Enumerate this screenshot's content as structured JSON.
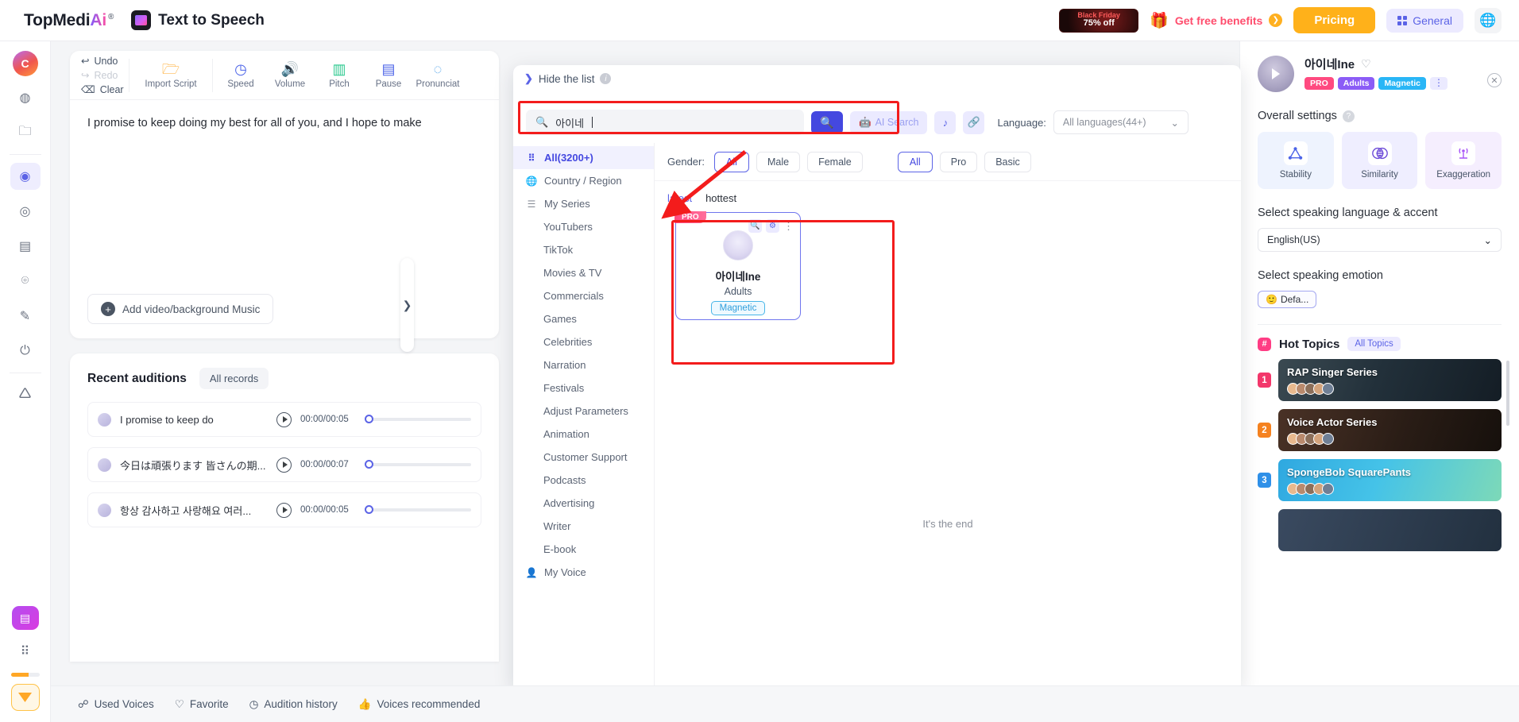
{
  "header": {
    "brand_main": "TopMedi",
    "brand_ai": "Ai",
    "brand_reg": "®",
    "app_title": "Text to Speech",
    "blackfriday_line1": "Black Friday",
    "blackfriday_line2": "75% off",
    "free_benefits": "Get free benefits",
    "pricing": "Pricing",
    "general": "General"
  },
  "rail": {
    "avatar_letter": "C"
  },
  "editor": {
    "undo": "Undo",
    "redo": "Redo",
    "clear": "Clear",
    "import_script": "Import Script",
    "tools": [
      {
        "label": "Speed"
      },
      {
        "label": "Volume"
      },
      {
        "label": "Pitch"
      },
      {
        "label": "Pause"
      },
      {
        "label": "Pronunciat"
      }
    ],
    "text": "I promise to keep doing my best for all of you, and I hope to make",
    "add_music": "Add video/background Music"
  },
  "recent": {
    "title": "Recent auditions",
    "all_records": "All records",
    "rows": [
      {
        "name": "I promise to keep do",
        "time": "00:00/00:05"
      },
      {
        "name": "今日は頑張ります 皆さんの期...",
        "time": "00:00/00:07"
      },
      {
        "name": "항상 감사하고 사랑해요 여러...",
        "time": "00:00/00:05"
      }
    ]
  },
  "bottombar": {
    "items": [
      {
        "label": "Used Voices",
        "icon": "used-voices-icon"
      },
      {
        "label": "Favorite",
        "icon": "heart-icon"
      },
      {
        "label": "Audition history",
        "icon": "clock-icon"
      },
      {
        "label": "Voices recommended",
        "icon": "thumbs-up-icon"
      }
    ]
  },
  "modal": {
    "hide_list": "Hide the list",
    "search_value": "아이네",
    "ai_search": "AI Search",
    "language_label": "Language:",
    "language_value": "All languages(44+)",
    "categories": [
      {
        "label": "All(3200+)",
        "icon": "grid-icon",
        "active": true,
        "sub": false
      },
      {
        "label": "Country / Region",
        "icon": "globe-icon",
        "active": false,
        "sub": false
      },
      {
        "label": "My Series",
        "icon": "layers-icon",
        "active": false,
        "sub": false
      },
      {
        "label": "YouTubers",
        "icon": "",
        "active": false,
        "sub": true
      },
      {
        "label": "TikTok",
        "icon": "",
        "active": false,
        "sub": true
      },
      {
        "label": "Movies & TV",
        "icon": "",
        "active": false,
        "sub": true
      },
      {
        "label": "Commercials",
        "icon": "",
        "active": false,
        "sub": true
      },
      {
        "label": "Games",
        "icon": "",
        "active": false,
        "sub": true
      },
      {
        "label": "Celebrities",
        "icon": "",
        "active": false,
        "sub": true
      },
      {
        "label": "Narration",
        "icon": "",
        "active": false,
        "sub": true
      },
      {
        "label": "Festivals",
        "icon": "",
        "active": false,
        "sub": true
      },
      {
        "label": "Adjust Parameters",
        "icon": "",
        "active": false,
        "sub": true
      },
      {
        "label": "Animation",
        "icon": "",
        "active": false,
        "sub": true
      },
      {
        "label": "Customer Support",
        "icon": "",
        "active": false,
        "sub": true
      },
      {
        "label": "Podcasts",
        "icon": "",
        "active": false,
        "sub": true
      },
      {
        "label": "Advertising",
        "icon": "",
        "active": false,
        "sub": true
      },
      {
        "label": "Writer",
        "icon": "",
        "active": false,
        "sub": true
      },
      {
        "label": "E-book",
        "icon": "",
        "active": false,
        "sub": true
      },
      {
        "label": "My Voice",
        "icon": "person-icon",
        "active": false,
        "sub": false
      }
    ],
    "gender_label": "Gender:",
    "gender_chips": [
      "All",
      "Male",
      "Female"
    ],
    "tier_chips": [
      "All",
      "Pro",
      "Basic"
    ],
    "sorts": [
      "latest",
      "hottest"
    ],
    "voice_card": {
      "pro": "PRO",
      "name": "아이네Ine",
      "age": "Adults",
      "tag": "Magnetic"
    },
    "end_note": "It's the end"
  },
  "right": {
    "voice_name": "아이네Ine",
    "tags": [
      {
        "label": "PRO",
        "cls": "pro"
      },
      {
        "label": "Adults",
        "cls": "adults"
      },
      {
        "label": "Magnetic",
        "cls": "magnetic"
      }
    ],
    "overall_settings": "Overall settings",
    "settings": [
      {
        "label": "Stability",
        "icon": "triangle-nodes-icon"
      },
      {
        "label": "Similarity",
        "icon": "venn-circles-icon"
      },
      {
        "label": "Exaggeration",
        "icon": "antenna-waves-icon"
      }
    ],
    "language_title": "Select speaking language & accent",
    "language_value": "English(US)",
    "emotion_title": "Select speaking emotion",
    "emotion_value": "Defa...",
    "hot_topics": "Hot Topics",
    "all_topics": "All Topics",
    "topics": [
      {
        "rank": "1",
        "title": "RAP Singer Series"
      },
      {
        "rank": "2",
        "title": "Voice Actor Series"
      },
      {
        "rank": "3",
        "title": "SpongeBob SquarePants"
      }
    ]
  }
}
